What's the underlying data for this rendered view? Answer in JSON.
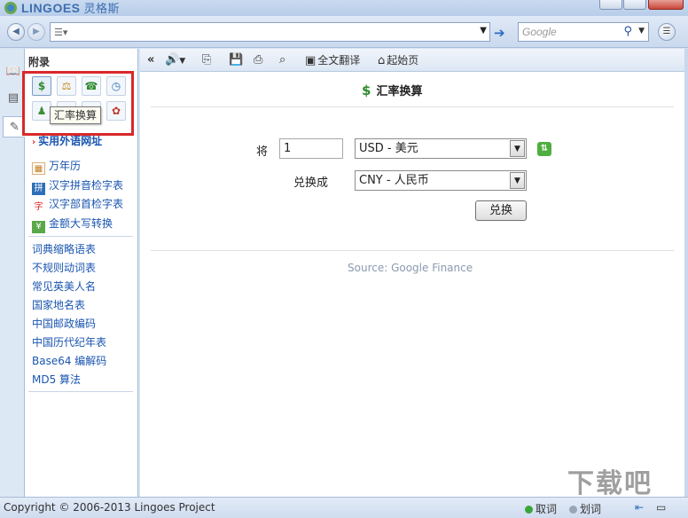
{
  "app": {
    "name": "LINGOES",
    "name_cn": "灵格斯"
  },
  "search": {
    "placeholder": "Google"
  },
  "left_panel": {
    "title": "附录",
    "tooltip": "汇率换算",
    "featured_link": "实用外语网址",
    "links_a": [
      "万年历",
      "汉字拼音检字表",
      "汉字部首检字表",
      "金额大写转换"
    ],
    "links_b": [
      "词典缩略语表",
      "不规则动词表",
      "常见英美人名",
      "国家地名表",
      "中国邮政编码",
      "中国历代纪年表",
      "Base64 编解码",
      "MD5 算法"
    ]
  },
  "toolbar": {
    "translate_label": "全文翻译",
    "home_label": "起始页"
  },
  "converter": {
    "title": "汇率换算",
    "from_label": "将",
    "amount": "1",
    "from_currency": "USD - 美元",
    "to_label": "兑换成",
    "to_currency": "CNY - 人民币",
    "convert_button": "兑换",
    "source": "Source: Google Finance"
  },
  "status": {
    "copyright": "Copyright © 2006-2013 Lingoes Project",
    "pick_word": "取词",
    "select_word": "划词"
  },
  "watermark": "下载吧"
}
